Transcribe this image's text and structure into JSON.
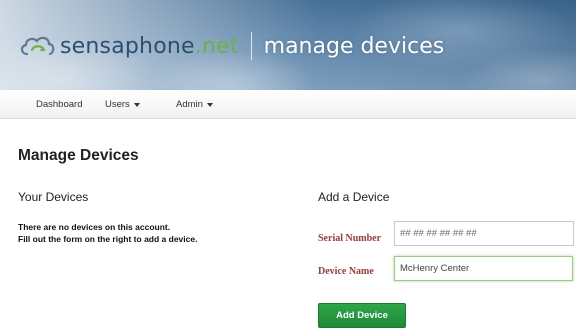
{
  "header": {
    "brand_name": "sensaphone",
    "brand_tld": ".net",
    "tagline": "manage devices",
    "logo_icon": "cloud-refresh-icon",
    "colors": {
      "brand_blue": "#2c4f6e",
      "brand_green": "#6fb04d"
    }
  },
  "nav": {
    "items": [
      {
        "label": "Dashboard",
        "dropdown": false
      },
      {
        "label": "Users",
        "dropdown": true
      },
      {
        "label": "Admin",
        "dropdown": true
      }
    ]
  },
  "main": {
    "page_title": "Manage Devices",
    "your_devices": {
      "title": "Your Devices",
      "empty_line1": "There are no devices on this account.",
      "empty_line2": "Fill out the form on the right to add a device."
    },
    "add_device": {
      "title": "Add a Device",
      "serial_label": "Serial Number",
      "serial_placeholder": "## ## ## ## ## ##",
      "serial_value": "",
      "name_label": "Device Name",
      "name_value": "McHenry Center",
      "submit_label": "Add Device",
      "colors": {
        "button_green": "#1d8a36",
        "label_red": "#a03c3c"
      }
    }
  }
}
